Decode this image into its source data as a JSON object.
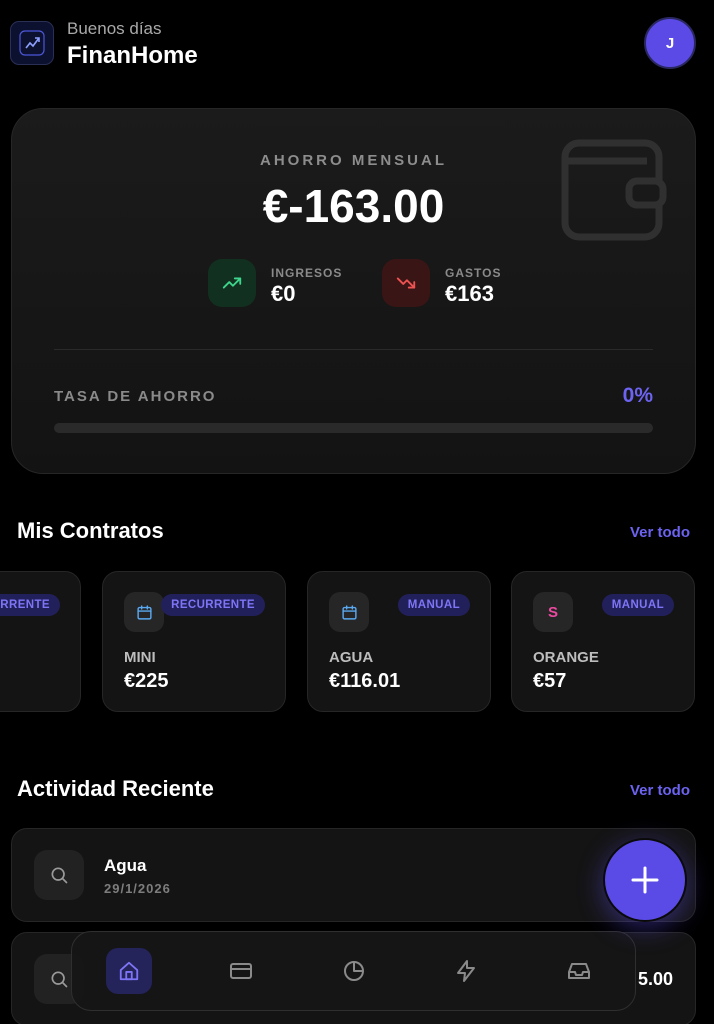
{
  "header": {
    "greeting": "Buenos días",
    "app_title": "FinanHome",
    "avatar_initial": "J"
  },
  "savings": {
    "label": "AHORRO MENSUAL",
    "amount": "€-163.00",
    "income_label": "INGRESOS",
    "income_value": "€0",
    "expense_label": "GASTOS",
    "expense_value": "€163",
    "rate_label": "TASA DE AHORRO",
    "rate_value": "0%",
    "rate_fraction": 0
  },
  "contracts": {
    "title": "Mis Contratos",
    "see_all": "Ver todo",
    "items": [
      {
        "badge": "RECURRENTE",
        "name": "",
        "amount": "",
        "icon": ""
      },
      {
        "badge": "RECURRENTE",
        "name": "MINI",
        "amount": "€225",
        "icon": "calendar-icon"
      },
      {
        "badge": "MANUAL",
        "name": "AGUA",
        "amount": "€116.01",
        "icon": "calendar-icon"
      },
      {
        "badge": "MANUAL",
        "name": "ORANGE",
        "amount": "€57",
        "icon": "S"
      }
    ]
  },
  "activity": {
    "title": "Actividad Reciente",
    "see_all": "Ver todo",
    "items": [
      {
        "name": "Agua",
        "date": "29/1/2026",
        "amount": ""
      },
      {
        "name": "",
        "date": "",
        "amount": "5.00"
      }
    ]
  },
  "nav": {
    "items": [
      "home-icon",
      "card-icon",
      "pie-chart-icon",
      "bolt-icon",
      "inbox-icon"
    ],
    "active": "home-icon"
  },
  "colors": {
    "accent": "#6c63f0",
    "income": "#3dd68c",
    "expense": "#f05252"
  }
}
